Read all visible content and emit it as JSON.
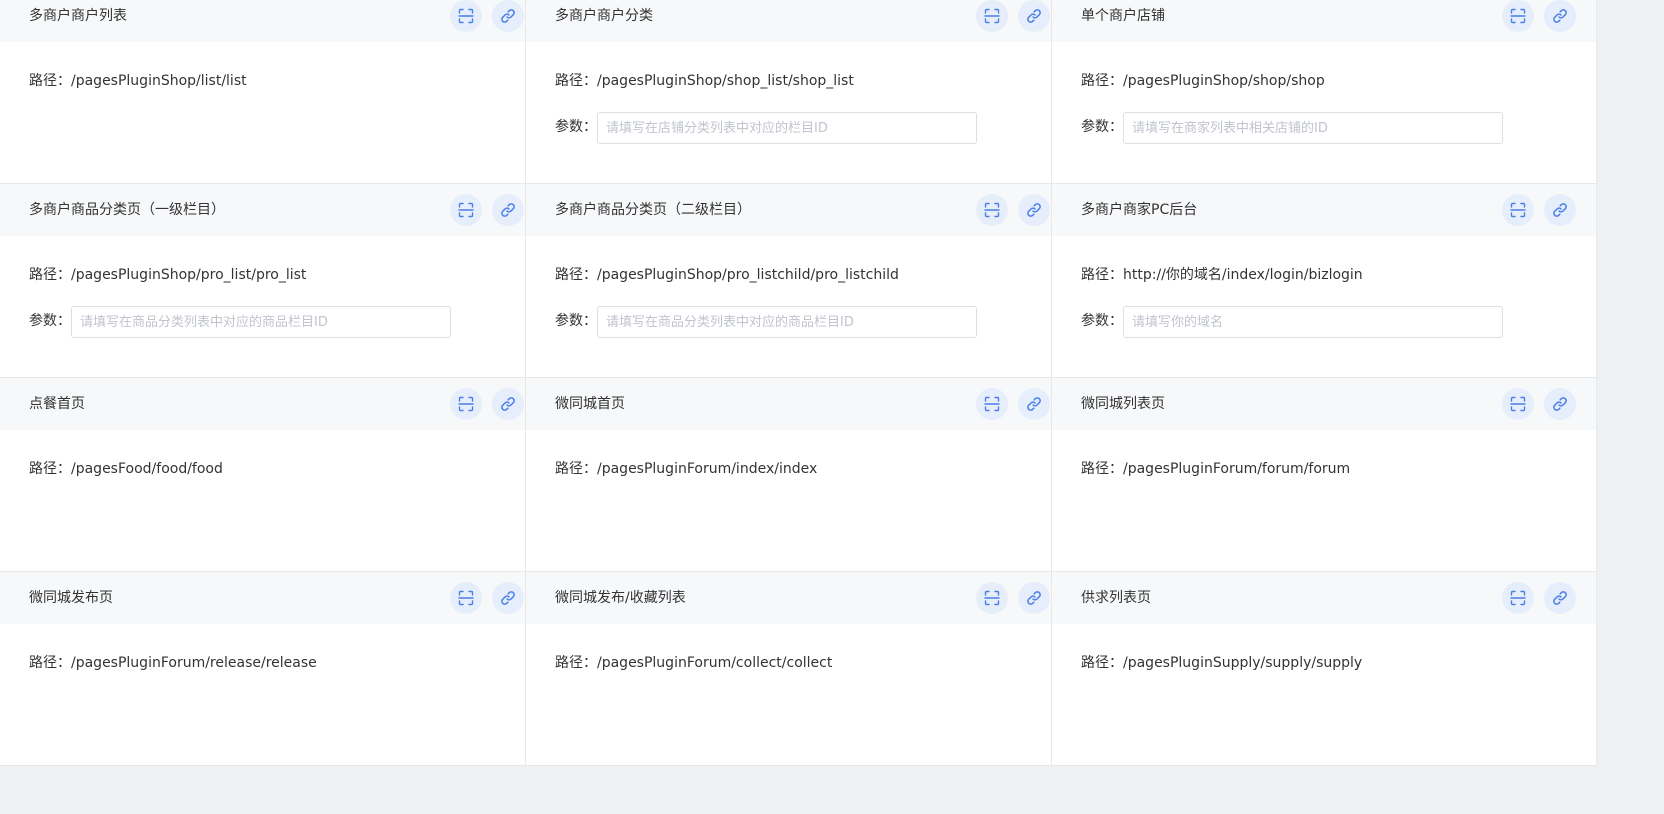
{
  "labels": {
    "path_prefix": "路径：",
    "param_label": "参数："
  },
  "colors": {
    "icon_accent": "#4a7fe8",
    "icon_button_bg": "#e6eefc",
    "header_bg": "#f7f8fa"
  },
  "icons": {
    "scan": "scan-icon",
    "link": "link-icon"
  },
  "cards": [
    {
      "title": "多商户商户列表",
      "path": "/pagesPluginShop/list/list",
      "param_placeholder": null
    },
    {
      "title": "多商户商户分类",
      "path": "/pagesPluginShop/shop_list/shop_list",
      "param_placeholder": "请填写在店铺分类列表中对应的栏目ID"
    },
    {
      "title": "单个商户店铺",
      "path": "/pagesPluginShop/shop/shop",
      "param_placeholder": "请填写在商家列表中相关店铺的ID"
    },
    {
      "title": "多商户商品分类页（一级栏目）",
      "path": "/pagesPluginShop/pro_list/pro_list",
      "param_placeholder": "请填写在商品分类列表中对应的商品栏目ID"
    },
    {
      "title": "多商户商品分类页（二级栏目）",
      "path": "/pagesPluginShop/pro_listchild/pro_listchild",
      "param_placeholder": "请填写在商品分类列表中对应的商品栏目ID"
    },
    {
      "title": "多商户商家PC后台",
      "path": "http://你的域名/index/login/bizlogin",
      "param_placeholder": "请填写你的域名"
    },
    {
      "title": "点餐首页",
      "path": "/pagesFood/food/food",
      "param_placeholder": null
    },
    {
      "title": "微同城首页",
      "path": "/pagesPluginForum/index/index",
      "param_placeholder": null
    },
    {
      "title": "微同城列表页",
      "path": "/pagesPluginForum/forum/forum",
      "param_placeholder": null
    },
    {
      "title": "微同城发布页",
      "path": "/pagesPluginForum/release/release",
      "param_placeholder": null
    },
    {
      "title": "微同城发布/收藏列表",
      "path": "/pagesPluginForum/collect/collect",
      "param_placeholder": null
    },
    {
      "title": "供求列表页",
      "path": "/pagesPluginSupply/supply/supply",
      "param_placeholder": null
    }
  ]
}
